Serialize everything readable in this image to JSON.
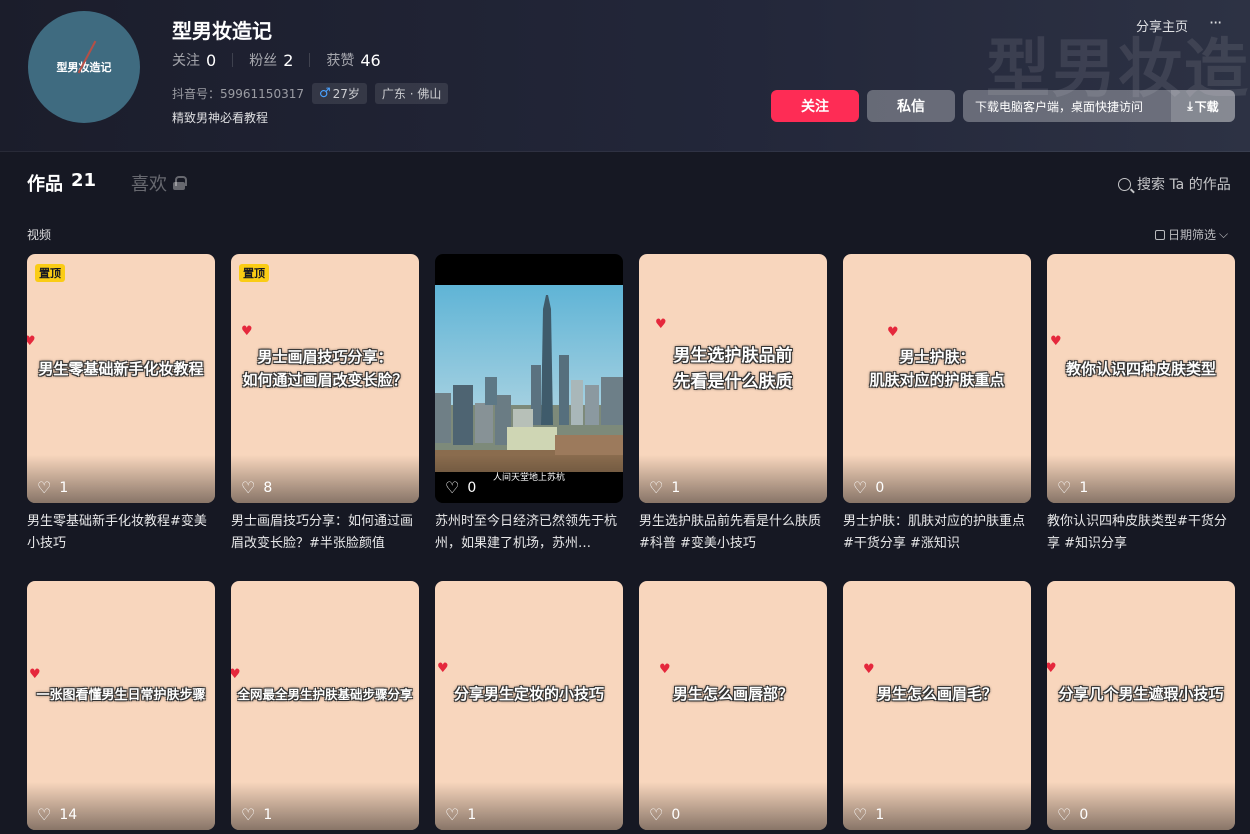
{
  "profile": {
    "avatar_text": "型男妆造记",
    "name": "型男妆造记",
    "watermark": "型男妆造",
    "following_label": "关注",
    "following_count": "0",
    "followers_label": "粉丝",
    "followers_count": "2",
    "likes_label": "获赞",
    "likes_count": "46",
    "douyin_id": "抖音号：59961150317",
    "age": "27岁",
    "location": "广东 · 佛山",
    "bio": "精致男神必看教程"
  },
  "top_actions": {
    "share_home": "分享主页",
    "more": "···"
  },
  "buttons": {
    "follow": "关注",
    "message": "私信",
    "download_text": "下载电脑客户端，桌面快捷访问",
    "download_btn": "下载"
  },
  "tabs": {
    "works_label": "作品",
    "works_count": "21",
    "likes_label": "喜欢"
  },
  "search": {
    "label": "搜索 Ta 的作品"
  },
  "section": {
    "label": "视频",
    "date_filter": "日期筛选"
  },
  "videos": [
    {
      "pinned": "置顶",
      "cover_text": "男生零基础新手化妆教程",
      "likes": "1",
      "title": "男生零基础新手化妆教程#变美小技巧"
    },
    {
      "pinned": "置顶",
      "cover_text": "男士画眉技巧分享：\n如何通过画眉改变长脸？",
      "likes": "8",
      "title": "男士画眉技巧分享：如何通过画眉改变长脸？#半张脸颜值"
    },
    {
      "cover_text": "人间天堂地上苏杭",
      "likes": "0",
      "title": "苏州时至今日经济已然领先于杭州，如果建了机场，苏州…"
    },
    {
      "cover_text": "男生选护肤品前\n先看是什么肤质",
      "likes": "1",
      "title": "男生选护肤品前先看是什么肤质#科普 #变美小技巧"
    },
    {
      "cover_text": "男士护肤：\n肌肤对应的护肤重点",
      "likes": "0",
      "title": "男士护肤：肌肤对应的护肤重点#干货分享 #涨知识"
    },
    {
      "cover_text": "教你认识四种皮肤类型",
      "likes": "1",
      "title": "教你认识四种皮肤类型#干货分享 #知识分享"
    },
    {
      "cover_text": "一张图看懂男生日常护肤步骤",
      "likes": "14"
    },
    {
      "cover_text": "全网最全男生护肤基础步骤分享",
      "likes": "1"
    },
    {
      "cover_text": "分享男生定妆的小技巧",
      "likes": "1"
    },
    {
      "cover_text": "男生怎么画唇部？",
      "likes": "0"
    },
    {
      "cover_text": "男生怎么画眉毛？",
      "likes": "1"
    },
    {
      "cover_text": "分享几个男生遮瑕小技巧",
      "likes": "0"
    }
  ]
}
